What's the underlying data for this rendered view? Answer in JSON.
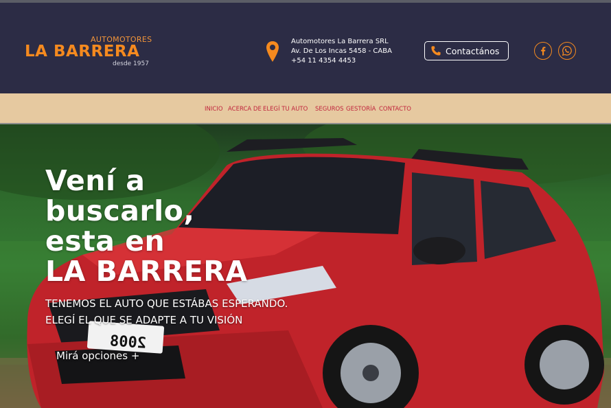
{
  "brand": {
    "top": "AUTOMOTORES",
    "name": "LA BARRERA",
    "since": "desde 1957",
    "accent": "#f58a1f"
  },
  "address": {
    "company": "Automotores La Barrera SRL",
    "street": "Av.  De Los Incas 5458  - CABA",
    "phone": "+54 11 4354 4453"
  },
  "contact_button": {
    "label": "Contactános",
    "icon": "phone-icon"
  },
  "social": [
    {
      "icon": "facebook-icon"
    },
    {
      "icon": "whatsapp-icon"
    }
  ],
  "nav": {
    "items": [
      "INICIO",
      "ACERCA DE",
      "ELEGÍ TU AUTO",
      "SEGUROS",
      "GESTORÍA",
      "CONTACTO"
    ]
  },
  "hero": {
    "title_lines": [
      "Vení a",
      "buscarlo,",
      "esta en",
      "LA BARRERA"
    ],
    "sub_lines": [
      "TENEMOS EL AUTO QUE ESTÁBAS ESPERANDO.",
      "ELEGÍ EL QUE SE ADAPTE A TU VISIÓN"
    ],
    "cta": "Mirá opciones +",
    "plate": "2008"
  },
  "colors": {
    "header_bg": "#2c2c45",
    "nav_bg": "#e6c9a0",
    "nav_text": "#c0243c",
    "car_red": "#c0232a"
  }
}
